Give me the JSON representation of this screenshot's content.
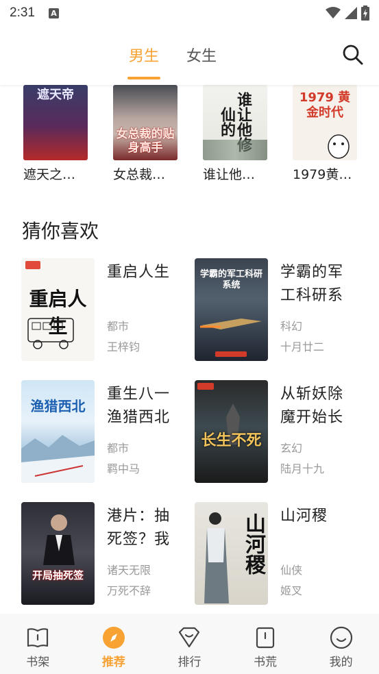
{
  "status_bar": {
    "time": "2:31",
    "notif_letter": "A"
  },
  "header": {
    "tabs": [
      {
        "label": "男生",
        "active": true
      },
      {
        "label": "女生",
        "active": false
      }
    ]
  },
  "top_books": [
    {
      "title": "遮天之…",
      "cover_text": "遮天帝"
    },
    {
      "title": "女总裁…",
      "cover_text": "女总裁的贴身高手"
    },
    {
      "title": "谁让他…",
      "cover_text": "谁让他修仙的"
    },
    {
      "title": "1979黄…",
      "cover_text": "1979 黄金时代"
    }
  ],
  "section": {
    "title": "猜你喜欢"
  },
  "books": [
    {
      "title": "重启人生",
      "genre": "都市",
      "author": "王梓钧",
      "cover_text": "重启人生"
    },
    {
      "title": "学霸的军工科研系",
      "genre": "科幻",
      "author": "十月廿二",
      "cover_text": "学霸的军工科研系统"
    },
    {
      "title": "重生八一渔猎西北",
      "genre": "都市",
      "author": "羁中马",
      "cover_text": "渔猎西北"
    },
    {
      "title": "从斩妖除魔开始长",
      "genre": "玄幻",
      "author": "陆月十九",
      "cover_text": "长生不死"
    },
    {
      "title": "港片：抽死签？我",
      "genre": "诸天无限",
      "author": "万死不辞",
      "cover_text": "开局抽死签"
    },
    {
      "title": "山河稷",
      "genre": "仙侠",
      "author": "姬叉",
      "cover_text": "山河稷"
    }
  ],
  "bottom_nav": [
    {
      "label": "书架",
      "icon": "bookshelf-icon",
      "active": false
    },
    {
      "label": "推荐",
      "icon": "compass-icon",
      "active": true
    },
    {
      "label": "排行",
      "icon": "ranking-icon",
      "active": false
    },
    {
      "label": "书荒",
      "icon": "book-famine-icon",
      "active": false
    },
    {
      "label": "我的",
      "icon": "profile-icon",
      "active": false
    }
  ],
  "colors": {
    "accent": "#f7a233",
    "text": "#222222",
    "muted": "#999999"
  }
}
